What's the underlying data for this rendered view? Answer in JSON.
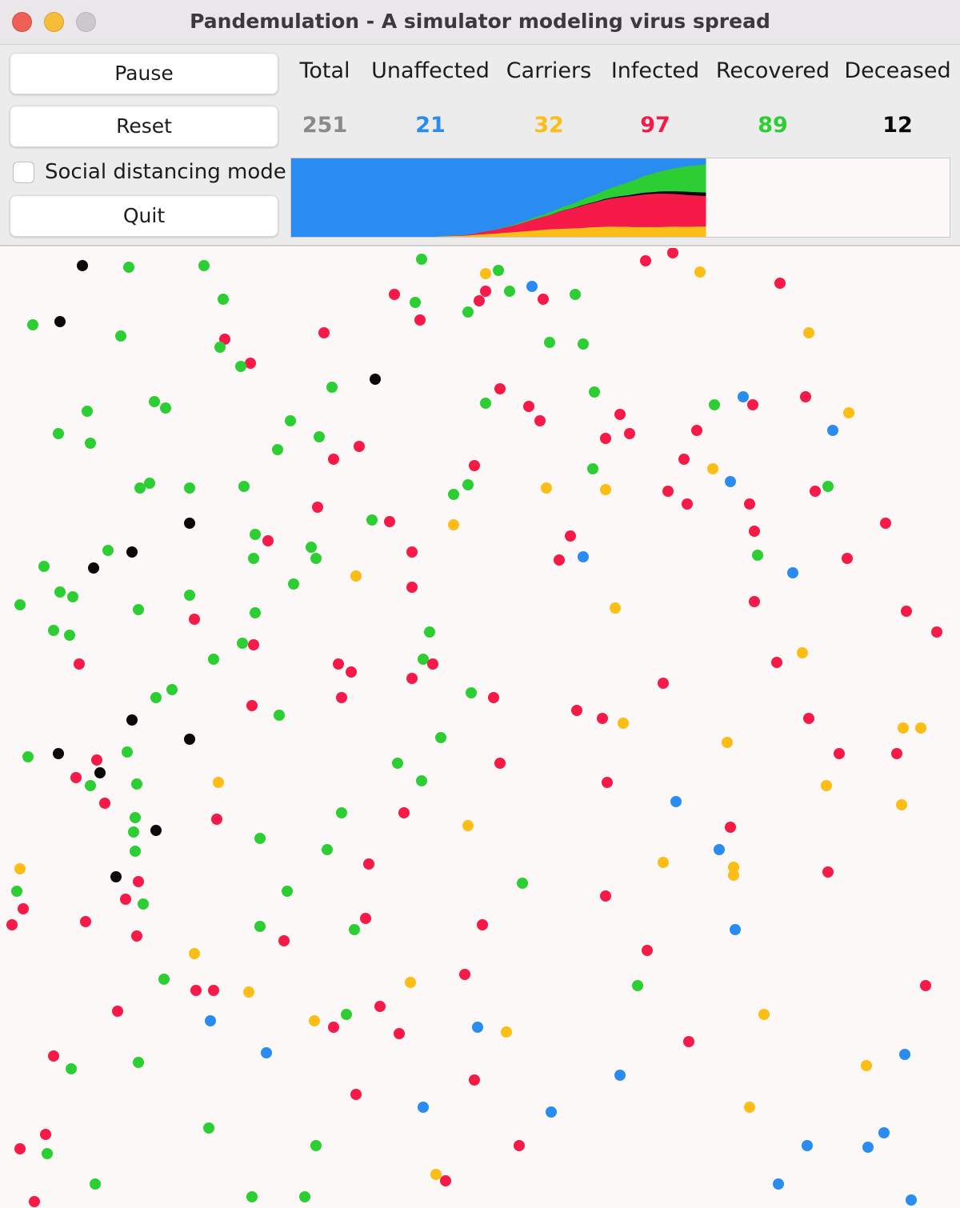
{
  "window": {
    "title": "Pandemulation - A simulator modeling virus spread"
  },
  "controls": {
    "pause_label": "Pause",
    "reset_label": "Reset",
    "social_distancing_label": "Social distancing mode",
    "social_distancing_checked": false,
    "quit_label": "Quit"
  },
  "stats": [
    {
      "key": "total",
      "label": "Total",
      "value": "251",
      "color": "#8a8a8a"
    },
    {
      "key": "unaffected",
      "label": "Unaffected",
      "value": "21",
      "color": "#2a8cf0"
    },
    {
      "key": "carriers",
      "label": "Carriers",
      "value": "32",
      "color": "#fbbd16"
    },
    {
      "key": "infected",
      "label": "Infected",
      "value": "97",
      "color": "#f51a47"
    },
    {
      "key": "recovered",
      "label": "Recovered",
      "value": "89",
      "color": "#2dce33"
    },
    {
      "key": "deceased",
      "label": "Deceased",
      "value": "12",
      "color": "#0a0a0a"
    }
  ],
  "colors": {
    "unaffected": "#2a8cf0",
    "carrier": "#fbbd16",
    "infected": "#f51a47",
    "recovered": "#2dce33",
    "deceased": "#0a0a0a"
  },
  "history_chart": {
    "type": "area",
    "stacked_order": [
      "carrier",
      "infected",
      "deceased",
      "recovered",
      "unaffected"
    ],
    "population": 251,
    "progress_fraction": 0.63,
    "carrier": [
      0,
      0,
      0,
      0,
      0,
      0,
      0,
      0,
      0,
      0,
      0,
      0,
      0,
      0,
      0,
      0,
      0,
      0,
      0,
      1,
      2,
      3,
      3,
      5,
      7,
      9,
      10,
      12,
      14,
      16,
      18,
      20,
      22,
      24,
      25,
      26,
      27,
      28,
      30,
      31,
      32,
      33,
      32,
      32,
      31,
      31,
      31,
      31,
      32,
      33,
      32,
      32,
      33,
      33
    ],
    "infected": [
      0,
      0,
      0,
      0,
      0,
      0,
      0,
      0,
      0,
      0,
      0,
      0,
      0,
      0,
      0,
      0,
      0,
      0,
      0,
      0,
      0,
      1,
      2,
      3,
      6,
      9,
      12,
      16,
      20,
      24,
      30,
      36,
      41,
      46,
      52,
      59,
      64,
      70,
      75,
      80,
      86,
      90,
      94,
      97,
      101,
      104,
      106,
      107,
      106,
      104,
      103,
      101,
      99,
      97
    ],
    "deceased": [
      0,
      0,
      0,
      0,
      0,
      0,
      0,
      0,
      0,
      0,
      0,
      0,
      0,
      0,
      0,
      0,
      0,
      0,
      0,
      0,
      0,
      0,
      0,
      0,
      0,
      0,
      0,
      0,
      0,
      0,
      0,
      0,
      0,
      0,
      1,
      1,
      1,
      2,
      2,
      2,
      3,
      3,
      4,
      4,
      5,
      6,
      6,
      7,
      8,
      9,
      10,
      11,
      11,
      12
    ],
    "recovered": [
      0,
      0,
      0,
      0,
      0,
      0,
      0,
      0,
      0,
      0,
      0,
      0,
      0,
      0,
      0,
      0,
      0,
      0,
      0,
      0,
      0,
      0,
      0,
      0,
      0,
      0,
      1,
      1,
      2,
      3,
      4,
      5,
      6,
      8,
      10,
      12,
      14,
      17,
      20,
      23,
      27,
      31,
      36,
      41,
      46,
      52,
      58,
      63,
      68,
      73,
      78,
      83,
      86,
      89
    ]
  },
  "simulation": {
    "people": [
      [
        "deceased",
        103,
        332
      ],
      [
        "recovered",
        161,
        334
      ],
      [
        "recovered",
        255,
        332
      ],
      [
        "recovered",
        527,
        324
      ],
      [
        "carrier",
        607,
        342
      ],
      [
        "recovered",
        623,
        338
      ],
      [
        "infected",
        807,
        326
      ],
      [
        "infected",
        841,
        316
      ],
      [
        "carrier",
        875,
        340
      ],
      [
        "blue",
        665,
        358
      ],
      [
        "recovered",
        637,
        364
      ],
      [
        "infected",
        607,
        364
      ],
      [
        "infected",
        679,
        374
      ],
      [
        "recovered",
        719,
        368
      ],
      [
        "infected",
        975,
        354
      ],
      [
        "recovered",
        279,
        374
      ],
      [
        "infected",
        493,
        368
      ],
      [
        "recovered",
        519,
        378
      ],
      [
        "infected",
        599,
        376
      ],
      [
        "recovered",
        585,
        390
      ],
      [
        "recovered",
        41,
        406
      ],
      [
        "deceased",
        75,
        402
      ],
      [
        "recovered",
        151,
        420
      ],
      [
        "infected",
        525,
        400
      ],
      [
        "infected",
        405,
        416
      ],
      [
        "infected",
        281,
        424
      ],
      [
        "recovered",
        275,
        434
      ],
      [
        "carrier",
        1011,
        416
      ],
      [
        "recovered",
        687,
        428
      ],
      [
        "recovered",
        729,
        430
      ],
      [
        "infected",
        313,
        454
      ],
      [
        "recovered",
        301,
        458
      ],
      [
        "deceased",
        469,
        474
      ],
      [
        "recovered",
        415,
        484
      ],
      [
        "infected",
        625,
        486
      ],
      [
        "recovered",
        743,
        490
      ],
      [
        "blue",
        929,
        496
      ],
      [
        "infected",
        1007,
        496
      ],
      [
        "recovered",
        193,
        502
      ],
      [
        "recovered",
        207,
        510
      ],
      [
        "recovered",
        109,
        514
      ],
      [
        "recovered",
        607,
        504
      ],
      [
        "infected",
        661,
        508
      ],
      [
        "recovered",
        893,
        506
      ],
      [
        "infected",
        941,
        506
      ],
      [
        "carrier",
        1061,
        516
      ],
      [
        "infected",
        775,
        518
      ],
      [
        "infected",
        675,
        526
      ],
      [
        "recovered",
        363,
        526
      ],
      [
        "recovered",
        73,
        542
      ],
      [
        "recovered",
        113,
        554
      ],
      [
        "recovered",
        399,
        546
      ],
      [
        "infected",
        871,
        538
      ],
      [
        "blue",
        1041,
        538
      ],
      [
        "infected",
        757,
        548
      ],
      [
        "infected",
        787,
        542
      ],
      [
        "infected",
        449,
        558
      ],
      [
        "recovered",
        347,
        562
      ],
      [
        "infected",
        417,
        574
      ],
      [
        "infected",
        855,
        574
      ],
      [
        "infected",
        593,
        582
      ],
      [
        "carrier",
        891,
        586
      ],
      [
        "recovered",
        741,
        586
      ],
      [
        "recovered",
        175,
        610
      ],
      [
        "recovered",
        187,
        604
      ],
      [
        "recovered",
        237,
        610
      ],
      [
        "recovered",
        305,
        608
      ],
      [
        "carrier",
        683,
        610
      ],
      [
        "recovered",
        585,
        606
      ],
      [
        "recovered",
        567,
        618
      ],
      [
        "carrier",
        757,
        612
      ],
      [
        "blue",
        913,
        602
      ],
      [
        "infected",
        835,
        614
      ],
      [
        "infected",
        1019,
        614
      ],
      [
        "recovered",
        1035,
        608
      ],
      [
        "infected",
        859,
        630
      ],
      [
        "infected",
        937,
        630
      ],
      [
        "infected",
        397,
        634
      ],
      [
        "deceased",
        237,
        654
      ],
      [
        "recovered",
        465,
        650
      ],
      [
        "infected",
        487,
        652
      ],
      [
        "carrier",
        567,
        656
      ],
      [
        "infected",
        1107,
        654
      ],
      [
        "infected",
        943,
        664
      ],
      [
        "recovered",
        319,
        668
      ],
      [
        "infected",
        335,
        676
      ],
      [
        "infected",
        713,
        670
      ],
      [
        "recovered",
        135,
        688
      ],
      [
        "deceased",
        165,
        690
      ],
      [
        "recovered",
        389,
        684
      ],
      [
        "recovered",
        395,
        698
      ],
      [
        "recovered",
        317,
        698
      ],
      [
        "infected",
        515,
        690
      ],
      [
        "infected",
        699,
        700
      ],
      [
        "blue",
        729,
        696
      ],
      [
        "recovered",
        947,
        694
      ],
      [
        "infected",
        1059,
        698
      ],
      [
        "recovered",
        55,
        708
      ],
      [
        "deceased",
        117,
        710
      ],
      [
        "carrier",
        445,
        720
      ],
      [
        "blue",
        991,
        716
      ],
      [
        "recovered",
        367,
        730
      ],
      [
        "infected",
        515,
        734
      ],
      [
        "recovered",
        75,
        740
      ],
      [
        "recovered",
        91,
        746
      ],
      [
        "recovered",
        237,
        744
      ],
      [
        "recovered",
        25,
        756
      ],
      [
        "infected",
        943,
        752
      ],
      [
        "recovered",
        173,
        762
      ],
      [
        "recovered",
        319,
        766
      ],
      [
        "carrier",
        769,
        760
      ],
      [
        "infected",
        1133,
        764
      ],
      [
        "infected",
        243,
        774
      ],
      [
        "recovered",
        67,
        788
      ],
      [
        "recovered",
        87,
        794
      ],
      [
        "recovered",
        537,
        790
      ],
      [
        "infected",
        1171,
        790
      ],
      [
        "recovered",
        303,
        804
      ],
      [
        "infected",
        317,
        806
      ],
      [
        "carrier",
        1003,
        816
      ],
      [
        "recovered",
        267,
        824
      ],
      [
        "infected",
        99,
        830
      ],
      [
        "infected",
        423,
        830
      ],
      [
        "recovered",
        529,
        824
      ],
      [
        "infected",
        541,
        830
      ],
      [
        "infected",
        439,
        840
      ],
      [
        "infected",
        971,
        828
      ],
      [
        "infected",
        515,
        848
      ],
      [
        "infected",
        829,
        854
      ],
      [
        "recovered",
        215,
        862
      ],
      [
        "recovered",
        195,
        872
      ],
      [
        "recovered",
        589,
        866
      ],
      [
        "infected",
        617,
        872
      ],
      [
        "infected",
        427,
        872
      ],
      [
        "infected",
        315,
        882
      ],
      [
        "infected",
        721,
        888
      ],
      [
        "recovered",
        349,
        894
      ],
      [
        "deceased",
        165,
        900
      ],
      [
        "infected",
        753,
        898
      ],
      [
        "carrier",
        779,
        904
      ],
      [
        "infected",
        1011,
        898
      ],
      [
        "carrier",
        1129,
        910
      ],
      [
        "carrier",
        1151,
        910
      ],
      [
        "deceased",
        237,
        924
      ],
      [
        "recovered",
        551,
        922
      ],
      [
        "carrier",
        909,
        928
      ],
      [
        "recovered",
        35,
        946
      ],
      [
        "deceased",
        73,
        942
      ],
      [
        "recovered",
        159,
        940
      ],
      [
        "infected",
        121,
        950
      ],
      [
        "infected",
        1049,
        942
      ],
      [
        "infected",
        1121,
        942
      ],
      [
        "recovered",
        497,
        954
      ],
      [
        "infected",
        625,
        954
      ],
      [
        "deceased",
        125,
        966
      ],
      [
        "infected",
        95,
        972
      ],
      [
        "recovered",
        113,
        982
      ],
      [
        "recovered",
        171,
        980
      ],
      [
        "carrier",
        273,
        978
      ],
      [
        "recovered",
        527,
        976
      ],
      [
        "infected",
        759,
        978
      ],
      [
        "carrier",
        1033,
        982
      ],
      [
        "blue",
        845,
        1002
      ],
      [
        "infected",
        131,
        1004
      ],
      [
        "carrier",
        1127,
        1006
      ],
      [
        "recovered",
        169,
        1022
      ],
      [
        "recovered",
        427,
        1016
      ],
      [
        "infected",
        505,
        1016
      ],
      [
        "infected",
        271,
        1024
      ],
      [
        "carrier",
        585,
        1032
      ],
      [
        "recovered",
        167,
        1040
      ],
      [
        "deceased",
        195,
        1038
      ],
      [
        "infected",
        913,
        1034
      ],
      [
        "recovered",
        325,
        1048
      ],
      [
        "recovered",
        169,
        1064
      ],
      [
        "recovered",
        409,
        1062
      ],
      [
        "blue",
        899,
        1062
      ],
      [
        "carrier",
        25,
        1086
      ],
      [
        "infected",
        461,
        1080
      ],
      [
        "carrier",
        829,
        1078
      ],
      [
        "carrier",
        917,
        1084
      ],
      [
        "carrier",
        917,
        1094
      ],
      [
        "infected",
        1035,
        1090
      ],
      [
        "deceased",
        145,
        1096
      ],
      [
        "infected",
        173,
        1102
      ],
      [
        "recovered",
        653,
        1104
      ],
      [
        "recovered",
        21,
        1114
      ],
      [
        "recovered",
        359,
        1114
      ],
      [
        "infected",
        757,
        1120
      ],
      [
        "infected",
        157,
        1124
      ],
      [
        "recovered",
        179,
        1130
      ],
      [
        "infected",
        29,
        1136
      ],
      [
        "infected",
        457,
        1148
      ],
      [
        "infected",
        107,
        1152
      ],
      [
        "infected",
        15,
        1156
      ],
      [
        "recovered",
        325,
        1158
      ],
      [
        "recovered",
        443,
        1162
      ],
      [
        "infected",
        603,
        1156
      ],
      [
        "blue",
        919,
        1162
      ],
      [
        "infected",
        171,
        1170
      ],
      [
        "infected",
        355,
        1176
      ],
      [
        "infected",
        809,
        1188
      ],
      [
        "carrier",
        243,
        1192
      ],
      [
        "infected",
        581,
        1218
      ],
      [
        "recovered",
        205,
        1224
      ],
      [
        "carrier",
        513,
        1228
      ],
      [
        "recovered",
        797,
        1232
      ],
      [
        "infected",
        1157,
        1232
      ],
      [
        "infected",
        245,
        1238
      ],
      [
        "infected",
        267,
        1238
      ],
      [
        "carrier",
        311,
        1240
      ],
      [
        "infected",
        475,
        1258
      ],
      [
        "infected",
        147,
        1264
      ],
      [
        "recovered",
        433,
        1268
      ],
      [
        "carrier",
        955,
        1268
      ],
      [
        "blue",
        263,
        1276
      ],
      [
        "carrier",
        393,
        1276
      ],
      [
        "infected",
        417,
        1284
      ],
      [
        "blue",
        597,
        1284
      ],
      [
        "carrier",
        633,
        1290
      ],
      [
        "infected",
        499,
        1292
      ],
      [
        "infected",
        861,
        1302
      ],
      [
        "blue",
        333,
        1316
      ],
      [
        "blue",
        1131,
        1318
      ],
      [
        "infected",
        67,
        1320
      ],
      [
        "recovered",
        173,
        1328
      ],
      [
        "carrier",
        1083,
        1332
      ],
      [
        "recovered",
        89,
        1336
      ],
      [
        "blue",
        775,
        1344
      ],
      [
        "infected",
        593,
        1350
      ],
      [
        "infected",
        445,
        1368
      ],
      [
        "blue",
        529,
        1384
      ],
      [
        "carrier",
        937,
        1384
      ],
      [
        "blue",
        689,
        1390
      ],
      [
        "recovered",
        261,
        1410
      ],
      [
        "blue",
        1105,
        1416
      ],
      [
        "infected",
        57,
        1418
      ],
      [
        "infected",
        25,
        1436
      ],
      [
        "recovered",
        59,
        1442
      ],
      [
        "recovered",
        395,
        1432
      ],
      [
        "infected",
        649,
        1432
      ],
      [
        "blue",
        1009,
        1432
      ],
      [
        "blue",
        1085,
        1434
      ],
      [
        "carrier",
        545,
        1468
      ],
      [
        "infected",
        557,
        1476
      ],
      [
        "recovered",
        119,
        1480
      ],
      [
        "blue",
        973,
        1480
      ],
      [
        "infected",
        43,
        1502
      ],
      [
        "recovered",
        315,
        1496
      ],
      [
        "recovered",
        381,
        1496
      ],
      [
        "blue",
        1139,
        1500
      ]
    ]
  }
}
